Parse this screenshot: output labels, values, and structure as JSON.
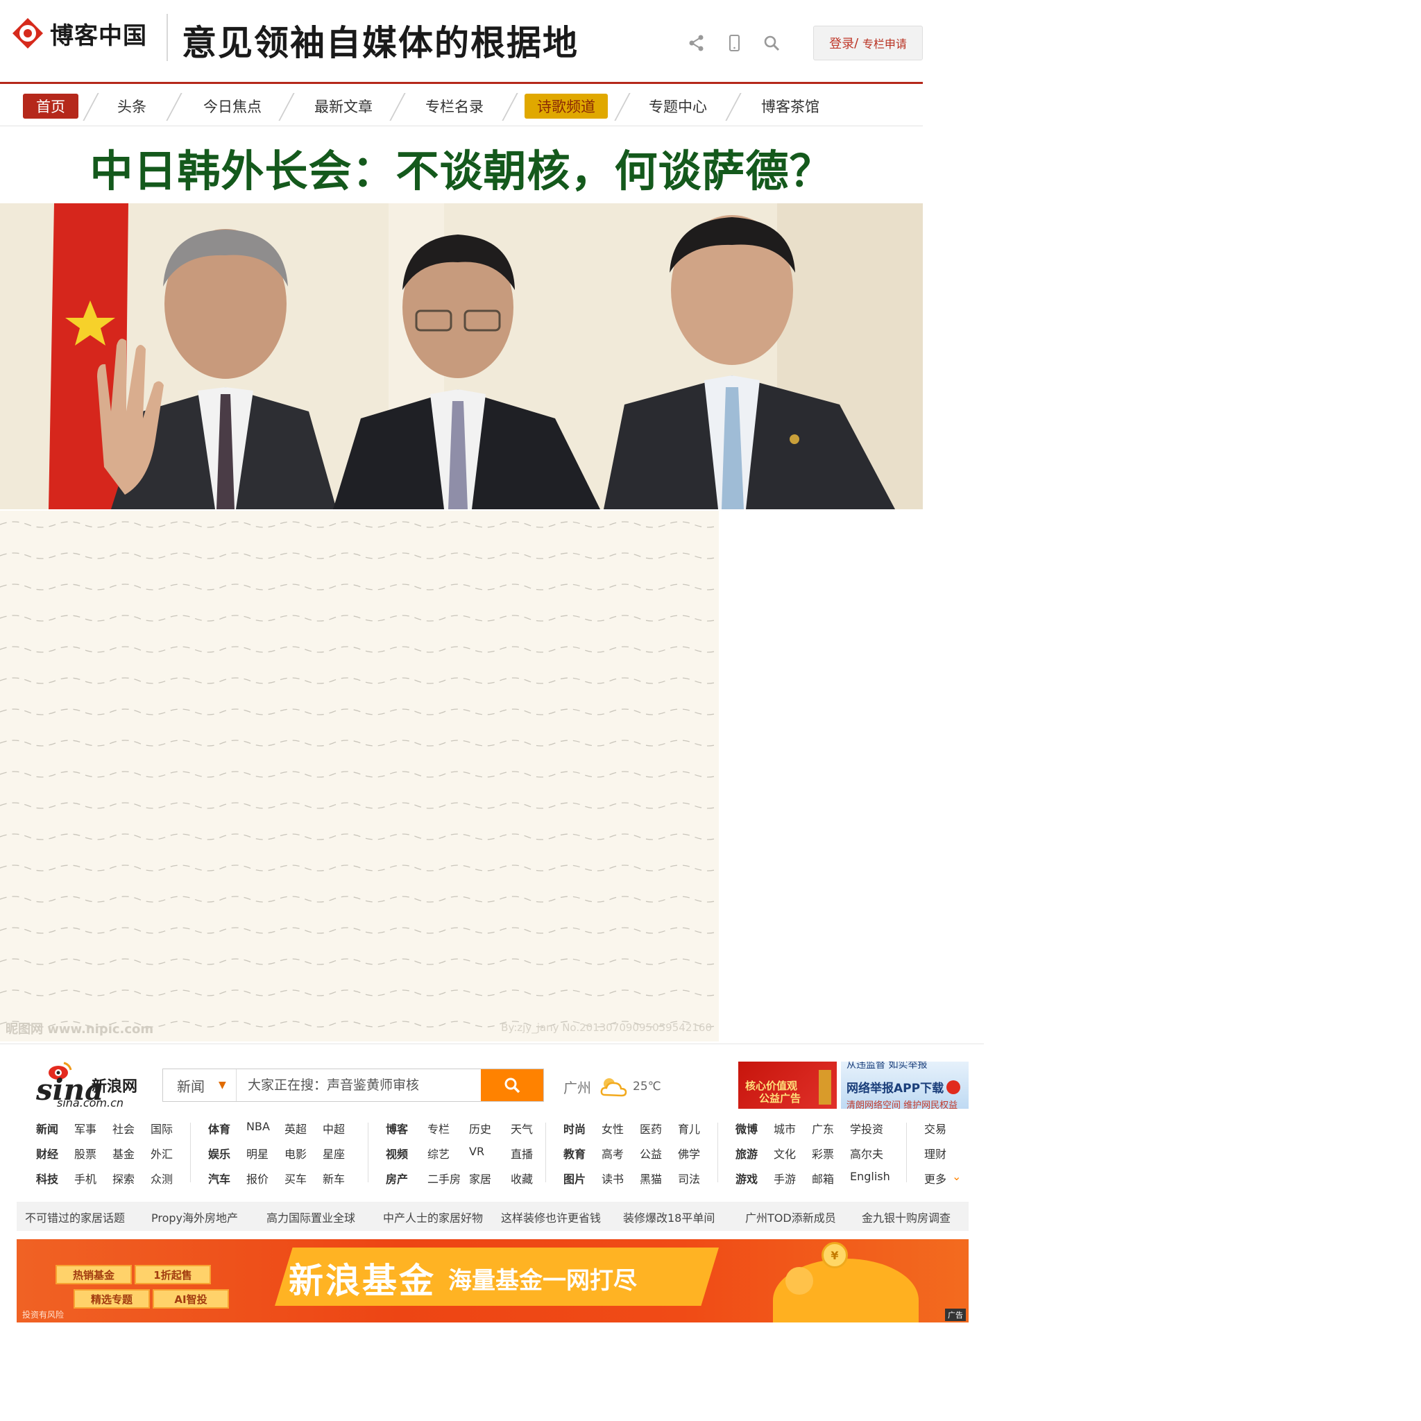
{
  "header": {
    "logo_text": "博客中国",
    "slogan": "意见领袖自媒体的根据地",
    "login_label": "登录",
    "login_sep": "/",
    "apply_label": "专栏申请",
    "accent_color": "#b5281b"
  },
  "nav": {
    "items": [
      "首页",
      "头条",
      "今日焦点",
      "最新文章",
      "专栏名录",
      "诗歌频道",
      "专题中心",
      "博客茶馆"
    ],
    "active_color": "#b5281b",
    "highlight_color": "#e0a800"
  },
  "article": {
    "headline": "中日韩外长会：不谈朝核，何谈萨德？",
    "headline_color": "#14591c"
  },
  "watermark": {
    "left": "昵图网 www.nipic.com",
    "right": "By:zjy_jany  No.20130709095059542160"
  },
  "sina": {
    "logo_word": "sina",
    "logo_cn": "新浪网",
    "logo_domain": "sina.com.cn",
    "search_category": "新闻",
    "search_placeholder": "大家正在搜：声音鉴黄师审核",
    "weather_city": "广州",
    "weather_temp": "25℃",
    "ad_core": [
      "核心价值观",
      "公益广告"
    ],
    "ad_report": [
      "从违监督 如实举报",
      "网络举报APP下载",
      "清朗网络空间 维护网民权益"
    ],
    "categories": [
      [
        [
          "新闻",
          "军事",
          "社会",
          "国际"
        ],
        [
          "财经",
          "股票",
          "基金",
          "外汇"
        ],
        [
          "科技",
          "手机",
          "探索",
          "众测"
        ]
      ],
      [
        [
          "体育",
          "NBA",
          "英超",
          "中超"
        ],
        [
          "娱乐",
          "明星",
          "电影",
          "星座"
        ],
        [
          "汽车",
          "报价",
          "买车",
          "新车"
        ]
      ],
      [
        [
          "博客",
          "专栏",
          "历史",
          "天气"
        ],
        [
          "视频",
          "综艺",
          "VR",
          "直播"
        ],
        [
          "房产",
          "二手房",
          "家居",
          "收藏"
        ]
      ],
      [
        [
          "时尚",
          "女性",
          "医药",
          "育儿"
        ],
        [
          "教育",
          "高考",
          "公益",
          "佛学"
        ],
        [
          "图片",
          "读书",
          "黑猫",
          "司法"
        ]
      ],
      [
        [
          "微博",
          "城市",
          "广东",
          "学投资"
        ],
        [
          "旅游",
          "文化",
          "彩票",
          "高尔夫"
        ],
        [
          "游戏",
          "手游",
          "邮箱",
          "English"
        ]
      ],
      [
        [
          "交易"
        ],
        [
          "理财"
        ],
        [
          "更多"
        ]
      ]
    ],
    "hot_links": [
      "不可错过的家居话题",
      "Propy海外房地产",
      "高力国际置业全球",
      "中产人士的家居好物",
      "这样装修也许更省钱",
      "装修爆改18平单间",
      "广州TOD添新成员",
      "金九银十购房调查"
    ],
    "fund_ad": {
      "buttons": [
        "热销基金",
        "1折起售",
        "精选专题",
        "AI智投"
      ],
      "title": "新浪基金",
      "subtitle": "海量基金一网打尽",
      "coin": "¥",
      "risk": "投资有风险",
      "tag": "广告"
    },
    "brand_color": "#ff8200"
  }
}
